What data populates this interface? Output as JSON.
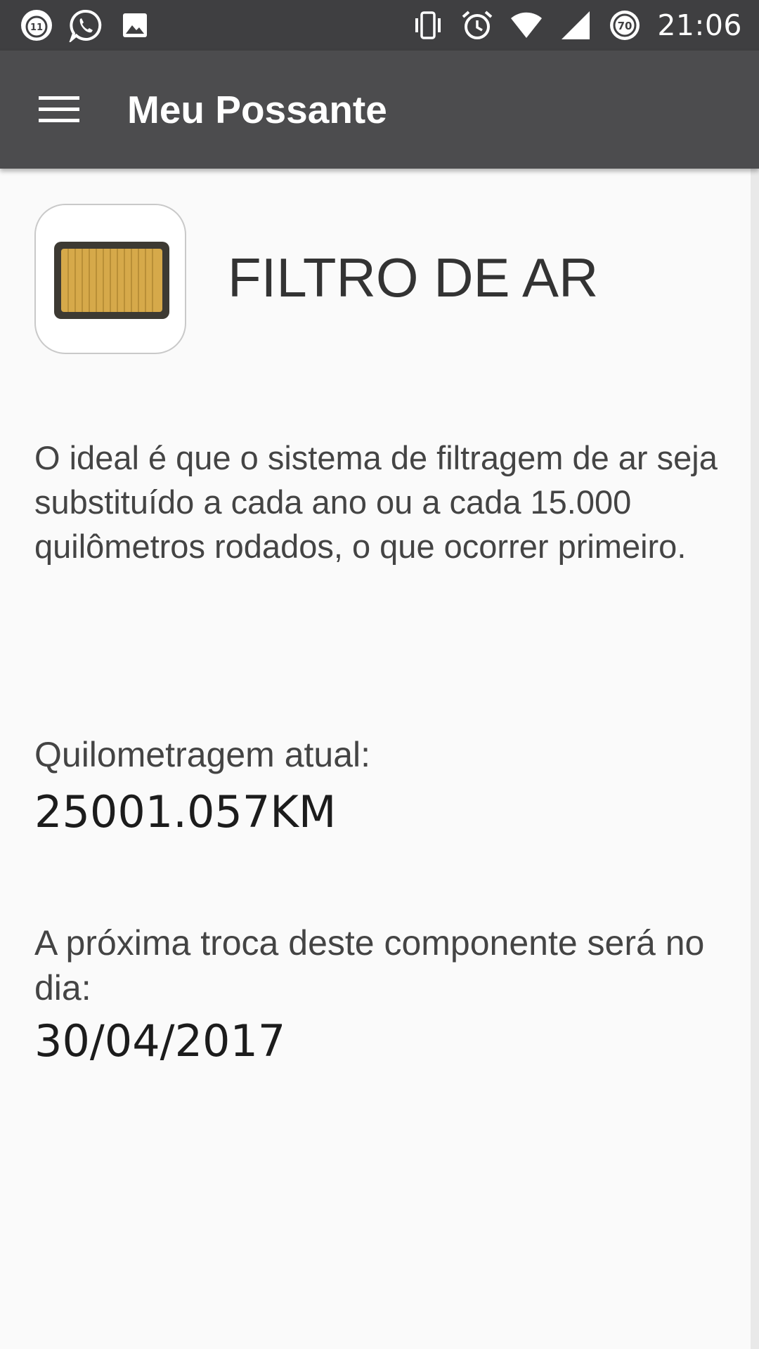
{
  "status_bar": {
    "icons_left": [
      "notification-11-icon",
      "whatsapp-icon",
      "image-icon"
    ],
    "notification_count": "11",
    "icons_right": [
      "vibrate-icon",
      "alarm-icon",
      "wifi-icon",
      "signal-icon",
      "battery-icon"
    ],
    "battery_level": "70",
    "time": "21:06"
  },
  "app_bar": {
    "menu_icon": "menu-icon",
    "title": "Meu Possante"
  },
  "component": {
    "icon": "air-filter-icon",
    "title": "FILTRO DE AR",
    "description": "O ideal é que o sistema de filtragem de ar seja substituído a cada ano ou a cada 15.000 quilômetros rodados, o que ocorrer primeiro.",
    "mileage_label": "Quilometragem atual:",
    "mileage_value": "25001.057KM",
    "next_change_label": "A próxima troca deste componente será no dia:",
    "next_change_date": "30/04/2017"
  },
  "colors": {
    "status_bar": "#3f3f41",
    "app_bar": "#4c4c4e",
    "background": "#fafafa",
    "filter_gold": "#d6a94a",
    "filter_frame": "#3d3a33"
  }
}
